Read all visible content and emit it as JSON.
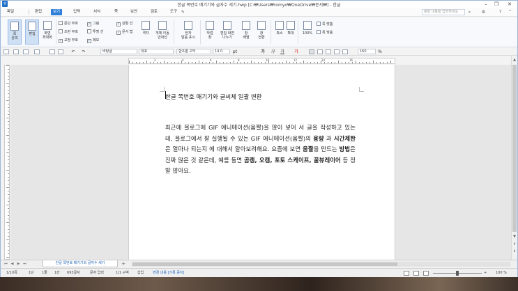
{
  "window": {
    "title": "한글 쪽번호 매기기와 글자수 세기.hwp [C:₩Users₩romyo₩OneDrive₩문서₩] - 한글",
    "logo": "ㅎ",
    "search_placeholder": "찾을 내용을 입력하세요",
    "controls": {
      "minimize": "–",
      "restore": "❐",
      "close": "✕"
    }
  },
  "menu": {
    "file": "파일",
    "items": [
      "편집",
      "보기",
      "입력",
      "서식",
      "쪽",
      "보안",
      "검토",
      "도구"
    ],
    "active_index": 1
  },
  "ribbon": {
    "big_buttons": [
      {
        "label": "쪽\n윤곽",
        "pressed": true
      },
      {
        "label": "편집",
        "pressed": true
      },
      {
        "label": "화면\n최대화",
        "pressed": false
      }
    ],
    "checks_col1": [
      {
        "label": "문단 부호",
        "checked": false
      },
      {
        "label": "조판 부호",
        "checked": false
      },
      {
        "label": "교정 부호",
        "checked": true
      }
    ],
    "checks_col2": [
      {
        "label": "그림",
        "checked": true
      },
      {
        "label": "투명 선",
        "checked": false
      },
      {
        "label": "메모",
        "checked": true
      }
    ],
    "checks_col3": [
      {
        "label": "상황 선",
        "checked": true
      },
      {
        "label": "문서 탭",
        "checked": true
      }
    ],
    "tool_buttons": [
      {
        "label": "격자"
      },
      {
        "label": "개체 이동\n안내선"
      },
      {
        "label": "한자\n발음 표시"
      },
      {
        "label": "작업\n창"
      },
      {
        "label": "편집 화면\n나누기"
      },
      {
        "label": "창\n배열"
      },
      {
        "label": "창\n전환"
      },
      {
        "label": "축소"
      },
      {
        "label": "확대"
      },
      {
        "label": "100%"
      }
    ],
    "right_small": [
      "쪽 맞춤",
      "폭 맞춤"
    ]
  },
  "toolbar": {
    "style": "바탕글",
    "language": "대표",
    "font": "함초롬 고딕",
    "font_size": "14.0",
    "size_unit": "pt",
    "bold": "가",
    "italic": "가",
    "underline": "가",
    "line_spacing": "160",
    "spacing_unit": "%"
  },
  "ruler": {
    "numbers": [
      "2",
      "4",
      "6",
      "8",
      "10",
      "12",
      "14",
      "16"
    ]
  },
  "document": {
    "title": "한글 쪽번호 매기기와 글씨체 일괄 변환",
    "body_parts": [
      {
        "t": "최근에 블로그에 GIF 애니메이션(움짤)을 많이 넣어 서 글을 작성하고 있는데, 블로그에서 잘 실행될 수 있는 GIF 애니메이션(움짤)의 ",
        "b": false
      },
      {
        "t": "용량",
        "b": true
      },
      {
        "t": " 과 ",
        "b": false
      },
      {
        "t": "시간제한",
        "b": true
      },
      {
        "t": " 은 얼마나 되는지 에 대해서 알아보려해요. 요즘에 보면 ",
        "b": false
      },
      {
        "t": "움짤",
        "b": true
      },
      {
        "t": "을 만드는 ",
        "b": false
      },
      {
        "t": "방법",
        "b": true
      },
      {
        "t": "은 진짜 많은 것 같은데, 예를 들면 ",
        "b": false
      },
      {
        "t": "곰캠, 오캠, 포토 스케이프, 꿀뷰레이어",
        "b": true
      },
      {
        "t": " 등 정말 많아요.",
        "b": false
      }
    ]
  },
  "tabs": {
    "document_tab": "한글 쪽번호 매기기와 글자수 세기",
    "add": "+"
  },
  "status": {
    "page": "1/10쪽",
    "section": "1단",
    "line": "1줄",
    "column": "1칸",
    "chars": "693글자",
    "mode": "문자 입력",
    "division": "1/1 구역",
    "insert": "삽입",
    "track": "변경 내용 [기록 중지]",
    "zoom": "100 %"
  }
}
